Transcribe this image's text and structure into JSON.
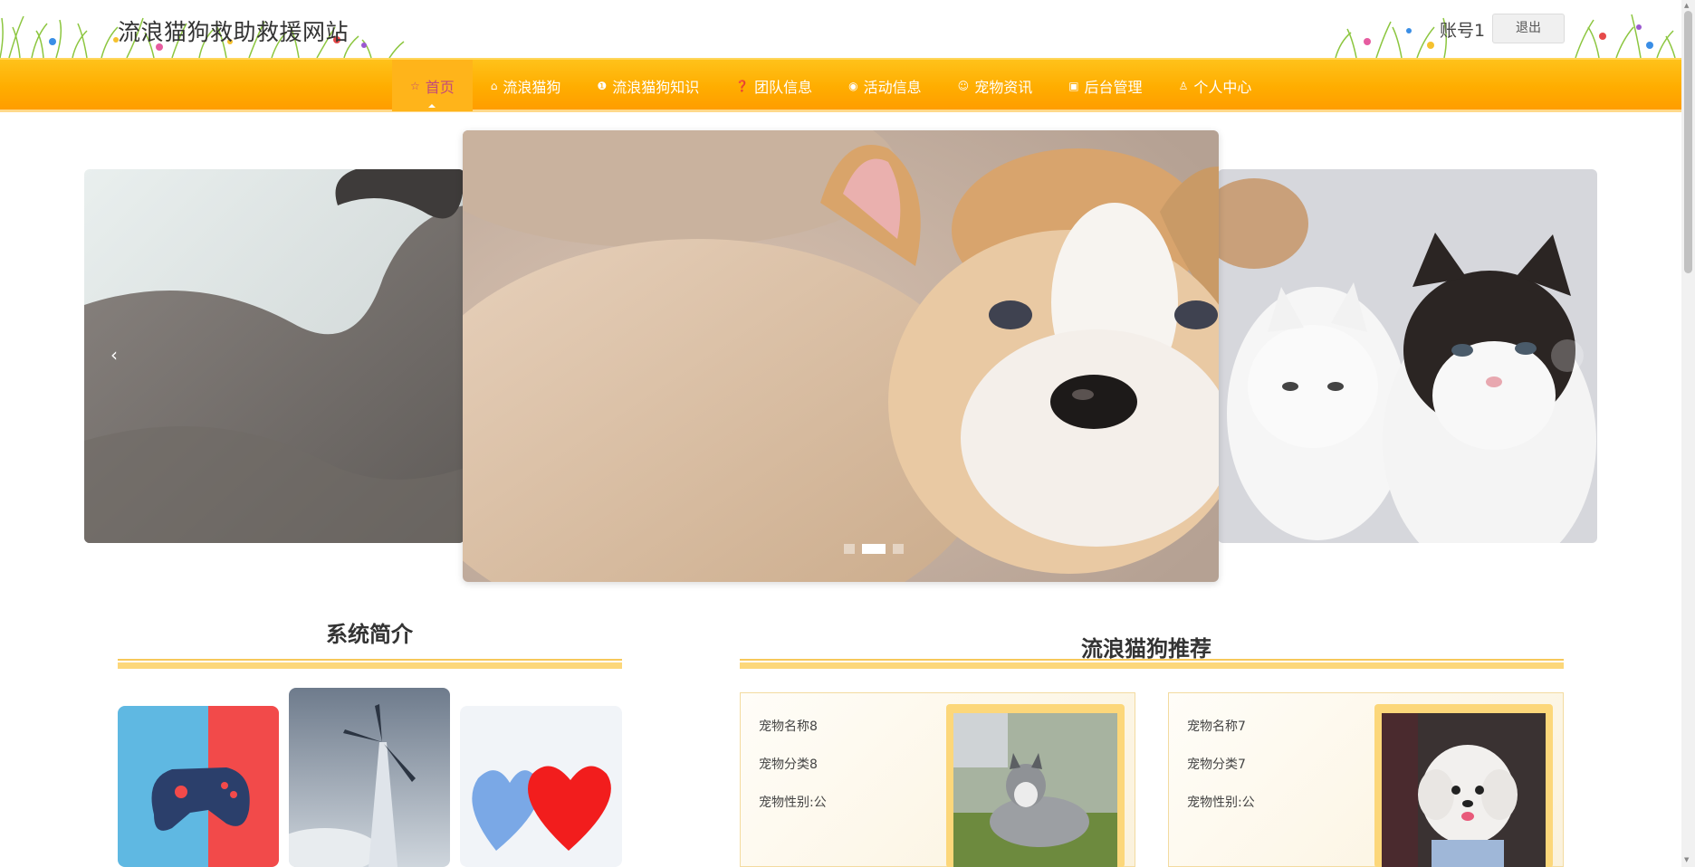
{
  "header": {
    "site_title": "流浪猫狗救助救援网站",
    "account": "账号1",
    "logout": "退出"
  },
  "nav": {
    "items": [
      {
        "label": "首页",
        "icon": "star-icon"
      },
      {
        "label": "流浪猫狗",
        "icon": "home-icon"
      },
      {
        "label": "流浪猫狗知识",
        "icon": "info-icon"
      },
      {
        "label": "团队信息",
        "icon": "question-icon"
      },
      {
        "label": "活动信息",
        "icon": "compass-icon"
      },
      {
        "label": "宠物资讯",
        "icon": "smile-icon"
      },
      {
        "label": "后台管理",
        "icon": "clipboard-icon"
      },
      {
        "label": "个人中心",
        "icon": "user-icon"
      }
    ],
    "active_index": 0
  },
  "carousel": {
    "slides": [
      "grey-cat-photo",
      "corgi-puppy-photo",
      "kittens-photo"
    ],
    "active_dot": 1,
    "dot_count": 3
  },
  "intro": {
    "title": "系统简介",
    "images": [
      "gamepad-photo",
      "wind-turbine-photo",
      "hearts-photo"
    ]
  },
  "recommend": {
    "title": "流浪猫狗推荐",
    "cards": [
      {
        "name": "宠物名称8",
        "category": "宠物分类8",
        "gender": "宠物性别:公",
        "photo": "husky-photo"
      },
      {
        "name": "宠物名称7",
        "category": "宠物分类7",
        "gender": "宠物性别:公",
        "photo": "poodle-photo"
      }
    ]
  },
  "colors": {
    "nav_top": "#ffc21a",
    "nav_bottom": "#ff9d00",
    "active_text": "#c24a7a",
    "deco": "#fcd77a"
  }
}
